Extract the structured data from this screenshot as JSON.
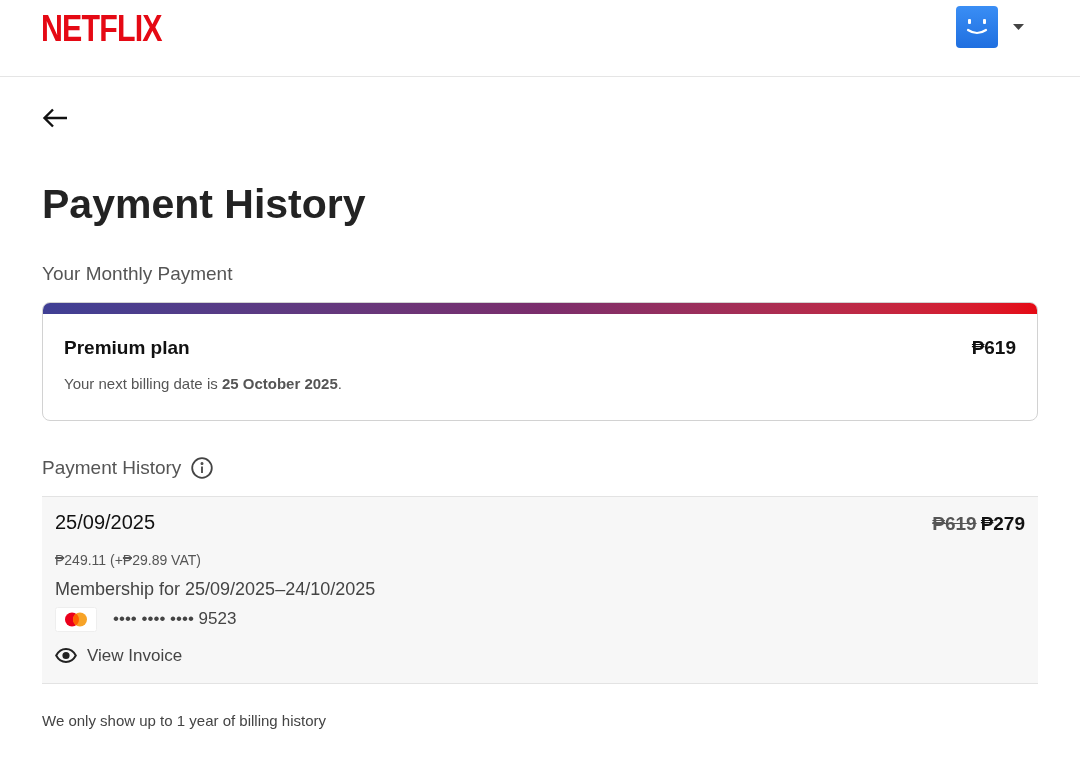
{
  "header": {
    "logo": "NETFLIX"
  },
  "page": {
    "title": "Payment History"
  },
  "monthly_payment": {
    "heading": "Your Monthly Payment",
    "plan": "Premium plan",
    "price": "₱619",
    "next_billing": "Your next billing date is **25 October 2025**."
  },
  "payment_history": {
    "heading": "Payment History",
    "payments": [
      {
        "date": "25/09/2025",
        "original_price": "₱619",
        "price": "₱279",
        "breakdown": "₱249.11 (+₱29.89 VAT)",
        "description": "Membership for 25/09/2025–24/10/2025",
        "card_number": "•••• •••• •••• 9523",
        "invoice_link": "View Invoice"
      }
    ]
  },
  "note": "We only show up to 1 year of billing history"
}
